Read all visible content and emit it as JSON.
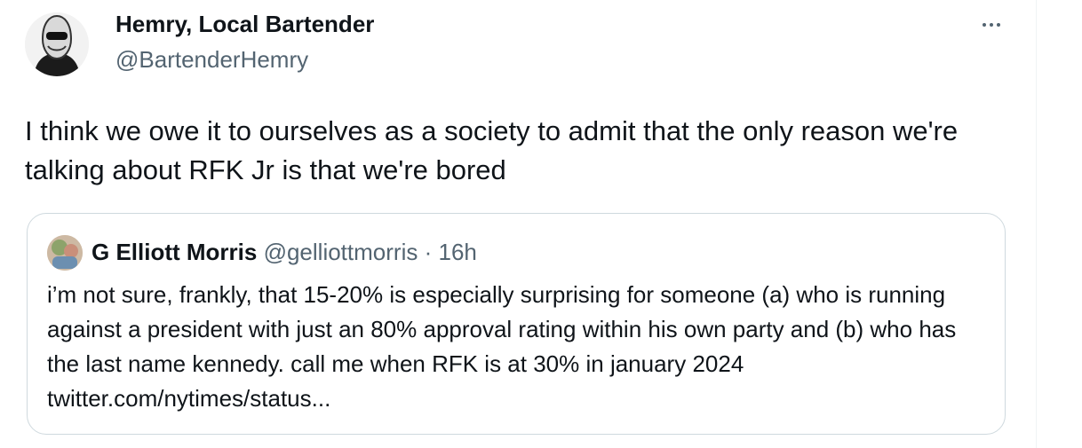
{
  "tweet": {
    "author_name": "Hemry, Local Bartender",
    "author_handle": "@BartenderHemry",
    "text": "I think we owe it to ourselves as a society to admit that the only reason we're talking about RFK Jr is that we're bored"
  },
  "quote": {
    "author_name": "G Elliott Morris",
    "author_handle": "@gelliottmorris",
    "separator": "·",
    "time": "16h",
    "text": "i’m not sure, frankly, that 15-20% is especially surprising for someone (a) who is running against a president with just an 80% approval rating within his own party and (b) who has the last name kennedy. call me when RFK is at 30% in january 2024 twitter.com/nytimes/status..."
  },
  "icons": {
    "more": "more-horizontal-icon"
  },
  "colors": {
    "text_primary": "#0f1419",
    "text_secondary": "#536471",
    "border": "#cfd9de"
  }
}
